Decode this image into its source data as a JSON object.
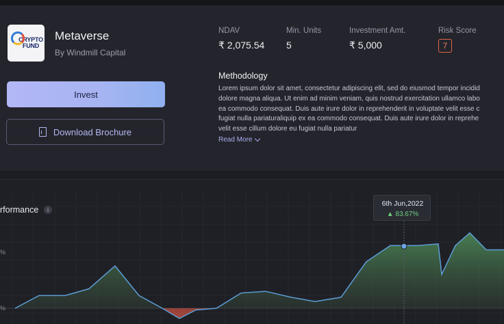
{
  "fund": {
    "name": "Metaverse",
    "manager": "By Windmill Capital",
    "logo_text_line1": "CRYPTO",
    "logo_text_line2": "FUND"
  },
  "actions": {
    "invest_label": "Invest",
    "download_label": "Download Brochure"
  },
  "stats": [
    {
      "label": "NDAV",
      "value": "₹ 2,075.54"
    },
    {
      "label": "Min. Units",
      "value": "5"
    },
    {
      "label": "Investment Amt.",
      "value": "₹ 5,000"
    },
    {
      "label": "Risk Score",
      "value": "7"
    }
  ],
  "methodology": {
    "title": "Methodology",
    "lines": [
      "Lorem ipsum dolor sit amet, consectetur adipiscing elit, sed do eiusmod tempor incidid",
      "dolore magna aliqua. Ut enim ad minim veniam, quis nostrud exercitation ullamco labo",
      "ea commodo consequat. Duis aute irure dolor in reprehenderit in voluptate velit esse c",
      "fugiat nulla pariaturaliquip ex ea commodo consequat. Duis aute irure dolor in reprehe",
      "velit esse cillum dolore eu fugiat nulla pariatur"
    ],
    "read_more": "Read More"
  },
  "performance": {
    "title": "rformance",
    "info": "i",
    "y_labels": [
      "%",
      "%"
    ],
    "tooltip": {
      "date": "6th Jun,2022",
      "value": "▲ 83.67%"
    },
    "colors": {
      "line": "#5d9ed6",
      "positive": "#4f8f5a",
      "negative": "#b44a3f",
      "point": "#6ea6e6"
    }
  },
  "chart_data": {
    "type": "area",
    "series": [
      {
        "values": [
          0,
          15,
          15,
          23,
          50,
          15,
          0,
          -12,
          -2,
          0,
          18,
          20,
          13,
          8,
          13,
          55,
          74,
          74,
          76,
          40,
          74,
          89,
          69,
          69,
          82
        ]
      }
    ],
    "highlight": {
      "date": "6th Jun,2022",
      "value": 83.67
    }
  }
}
